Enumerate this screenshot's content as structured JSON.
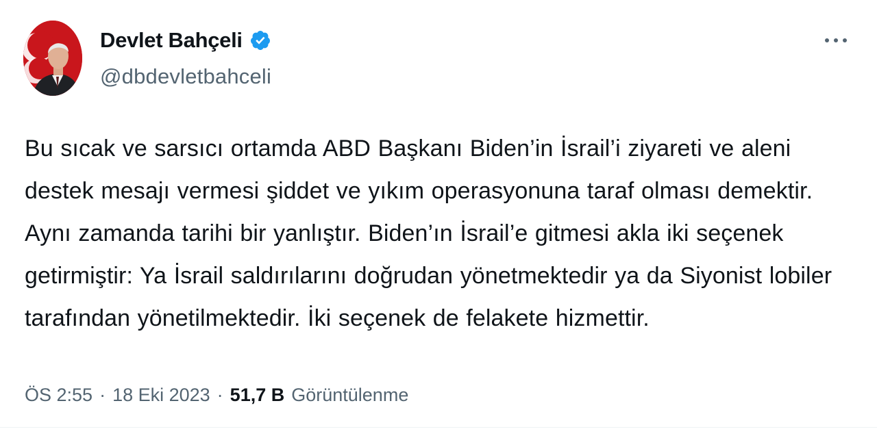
{
  "author": {
    "display_name": "Devlet Bahçeli",
    "handle": "@dbdevletbahceli",
    "verified": true
  },
  "tweet": {
    "text": "Bu sıcak ve sarsıcı ortamda ABD Başkanı Biden’in İsrail’i ziyareti ve aleni destek mesajı vermesi şiddet ve yıkım operasyonuna taraf olması demektir. Aynı zamanda tarihi bir yanlıştır. Biden’ın İsrail’e gitmesi akla iki seçenek getirmiştir: Ya İsrail saldırılarını doğrudan yönetmektedir ya da Siyonist lobiler tarafından yönetilmektedir. İki seçenek de felakete hizmettir."
  },
  "meta": {
    "time": "ÖS 2:55",
    "separator": "·",
    "date": "18 Eki 2023",
    "views_count": "51,7 B",
    "views_label": "Görüntülenme"
  },
  "icons": {
    "verified": "verified-badge-icon",
    "more": "more-options-icon"
  },
  "colors": {
    "verified": "#1d9bf0",
    "text_primary": "#0f1419",
    "text_secondary": "#536471",
    "avatar_bg": "#c9161c"
  }
}
